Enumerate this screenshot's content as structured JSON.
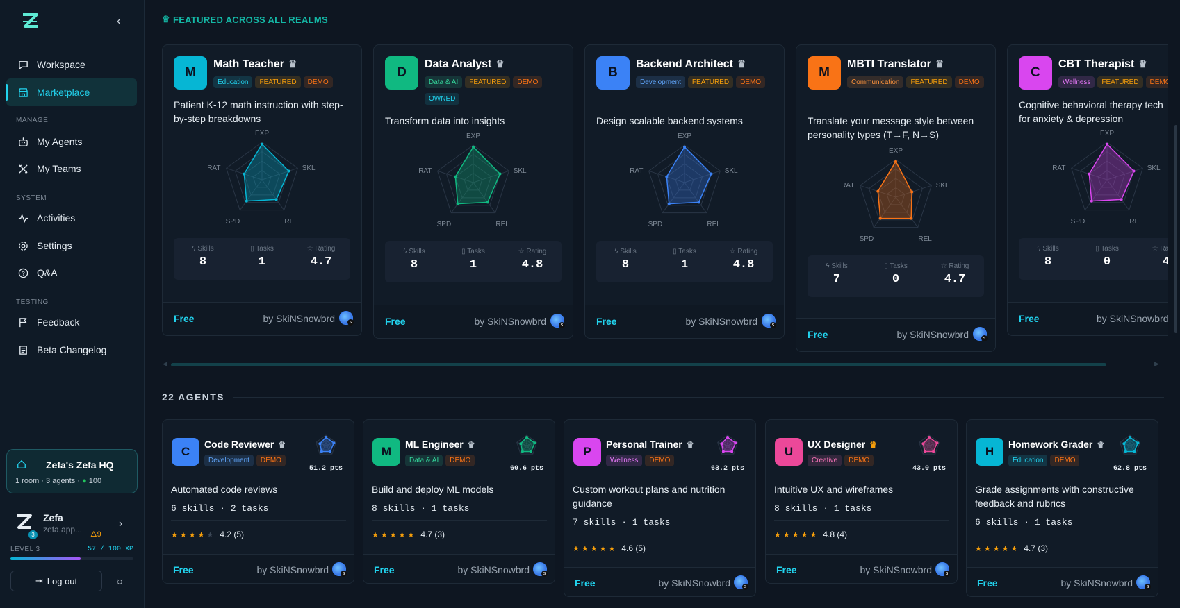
{
  "sidebar": {
    "nav": [
      {
        "label": "Workspace",
        "icon": "workspace-icon"
      },
      {
        "label": "Marketplace",
        "icon": "store-icon"
      }
    ],
    "manage_label": "MANAGE",
    "manage": [
      {
        "label": "My Agents",
        "icon": "bot-icon"
      },
      {
        "label": "My Teams",
        "icon": "teams-icon"
      }
    ],
    "system_label": "SYSTEM",
    "system": [
      {
        "label": "Activities",
        "icon": "activity-icon"
      },
      {
        "label": "Settings",
        "icon": "gear-icon"
      },
      {
        "label": "Q&A",
        "icon": "help-icon"
      }
    ],
    "testing_label": "TESTING",
    "testing": [
      {
        "label": "Feedback",
        "icon": "flag-icon"
      },
      {
        "label": "Beta Changelog",
        "icon": "changelog-icon"
      }
    ],
    "hq": {
      "title": "Zefa's Zefa HQ",
      "rooms": "1 room",
      "agents": "3 agents",
      "coins": "100"
    },
    "user": {
      "name": "Zefa",
      "email": "zefa.app...",
      "streak": "9",
      "badge": "3"
    },
    "level": "LEVEL 3",
    "xp": "57 / 100 XP",
    "xp_fraction": 0.57,
    "logout": "Log out"
  },
  "featured": {
    "heading": "FEATURED ACROSS ALL REALMS",
    "labels": {
      "skills": "Skills",
      "tasks": "Tasks",
      "rating": "Rating",
      "exp": "EXP",
      "skl": "SKL",
      "rel": "REL",
      "spd": "SPD",
      "rat": "RAT"
    },
    "cards": [
      {
        "letter": "M",
        "name": "Math Teacher",
        "color": "#06b6d4",
        "category": "Education",
        "owned": false,
        "desc1": "Patient K-12 math instruction with step-",
        "desc2": "by-step breakdowns",
        "skills": "8",
        "tasks": "1",
        "rating": "4.7",
        "price": "Free",
        "author": "by SkiNSnowbrd"
      },
      {
        "letter": "D",
        "name": "Data Analyst",
        "color": "#10b981",
        "category": "Data & AI",
        "owned": true,
        "desc1": "Transform data into insights",
        "desc2": "",
        "skills": "8",
        "tasks": "1",
        "rating": "4.8",
        "price": "Free",
        "author": "by SkiNSnowbrd"
      },
      {
        "letter": "B",
        "name": "Backend Architect",
        "color": "#3b82f6",
        "category": "Development",
        "owned": false,
        "desc1": "Design scalable backend systems",
        "desc2": "",
        "skills": "8",
        "tasks": "1",
        "rating": "4.8",
        "price": "Free",
        "author": "by SkiNSnowbrd"
      },
      {
        "letter": "M",
        "name": "MBTI Translator",
        "color": "#f97316",
        "category": "Communication",
        "owned": false,
        "desc1": "Translate your message style between",
        "desc2": "personality types (T→F, N→S)",
        "skills": "7",
        "tasks": "0",
        "rating": "4.7",
        "price": "Free",
        "author": "by SkiNSnowbrd"
      },
      {
        "letter": "C",
        "name": "CBT Therapist",
        "color": "#d946ef",
        "category": "Wellness",
        "owned": false,
        "desc1": "Cognitive behavioral therapy tech",
        "desc2": "for anxiety & depression",
        "skills": "8",
        "tasks": "0",
        "rating": "4",
        "price": "Free",
        "author": "by SkiNSnowbrd"
      }
    ],
    "tag_featured": "FEATURED",
    "tag_demo": "DEMO",
    "tag_owned": "OWNED"
  },
  "agents": {
    "heading": "22 AGENTS",
    "cards": [
      {
        "letter": "C",
        "name": "Code Reviewer",
        "color": "#3b82f6",
        "category": "Development",
        "pts": "51.2 pts",
        "desc": "Automated code reviews",
        "meta": "6 skills · 2 tasks",
        "rating": "4.2 (5)",
        "stars": 4,
        "price": "Free",
        "author": "by SkiNSnowbrd"
      },
      {
        "letter": "M",
        "name": "ML Engineer",
        "color": "#10b981",
        "category": "Data & AI",
        "pts": "60.6 pts",
        "desc": "Build and deploy ML models",
        "meta": "8 skills · 1 tasks",
        "rating": "4.7 (3)",
        "stars": 5,
        "price": "Free",
        "author": "by SkiNSnowbrd"
      },
      {
        "letter": "P",
        "name": "Personal Trainer",
        "color": "#d946ef",
        "category": "Wellness",
        "pts": "63.2 pts",
        "desc": "Custom workout plans and nutrition guidance",
        "meta": "7 skills · 1 tasks",
        "rating": "4.6 (5)",
        "stars": 5,
        "price": "Free",
        "author": "by SkiNSnowbrd"
      },
      {
        "letter": "U",
        "name": "UX Designer",
        "color": "#ec4899",
        "category": "Creative",
        "pts": "43.0 pts",
        "desc": "Intuitive UX and wireframes",
        "meta": "8 skills · 1 tasks",
        "rating": "4.8 (4)",
        "stars": 5,
        "price": "Free",
        "author": "by SkiNSnowbrd"
      },
      {
        "letter": "H",
        "name": "Homework Grader",
        "color": "#06b6d4",
        "category": "Education",
        "pts": "62.8 pts",
        "desc": "Grade assignments with constructive feedback and rubrics",
        "meta": "6 skills · 1 tasks",
        "rating": "4.7 (3)",
        "stars": 5,
        "price": "Free",
        "author": "by SkiNSnowbrd"
      }
    ],
    "tag_demo": "DEMO"
  }
}
